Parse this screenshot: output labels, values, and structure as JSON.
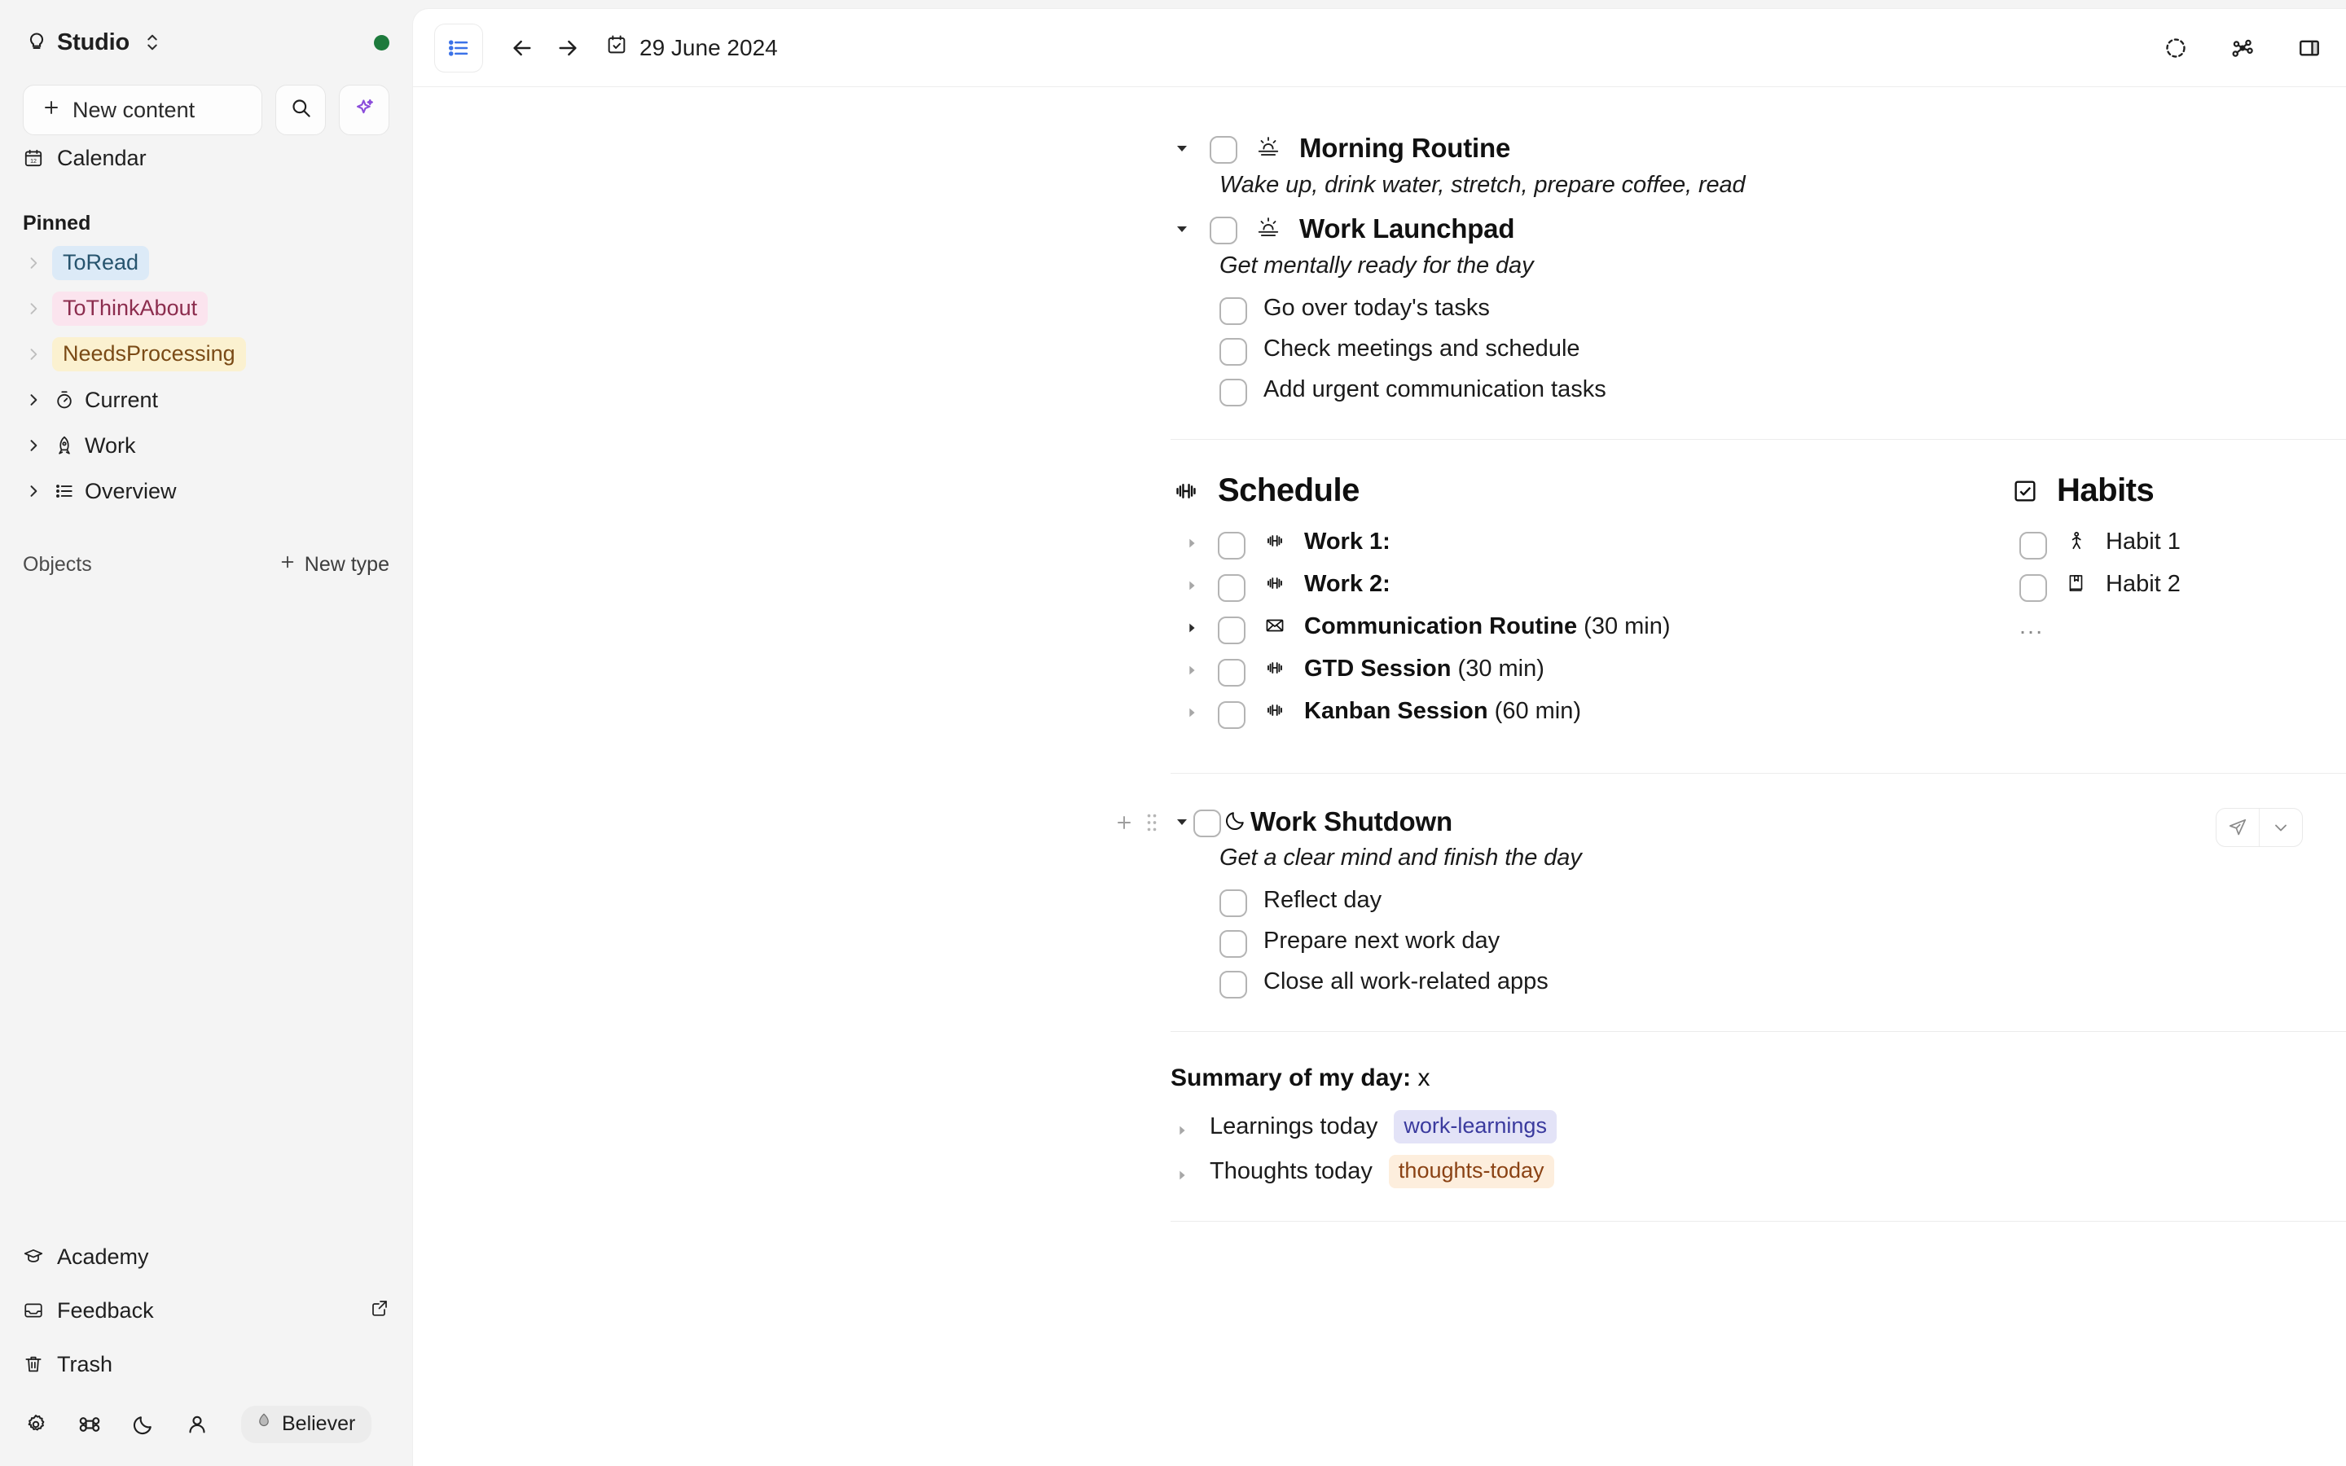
{
  "sidebar": {
    "space_name": "Studio",
    "space_icon": "bulb-icon",
    "status_dot_color": "#1d7a3c",
    "new_content_label": "New content",
    "search_icon": "search-icon",
    "ai_icon": "sparkles-icon",
    "calendar_label": "Calendar",
    "pinned_title": "Pinned",
    "pinned": [
      {
        "label": "ToRead",
        "bg": "#dceaf7",
        "fg": "#27546e",
        "kind": "tag"
      },
      {
        "label": "ToThinkAbout",
        "bg": "#fbe4ee",
        "fg": "#8c2d4e",
        "kind": "tag"
      },
      {
        "label": "NeedsProcessing",
        "bg": "#fbf1d0",
        "fg": "#7a4a16",
        "kind": "tag"
      }
    ],
    "tree": [
      {
        "label": "Current",
        "icon": "stopwatch-icon"
      },
      {
        "label": "Work",
        "icon": "rocket-icon"
      },
      {
        "label": "Overview",
        "icon": "list-icon"
      }
    ],
    "objects_title": "Objects",
    "new_type_label": "New type",
    "footer": [
      {
        "label": "Academy",
        "icon": "graduation-cap-icon",
        "external": false
      },
      {
        "label": "Feedback",
        "icon": "inbox-icon",
        "external": true
      },
      {
        "label": "Trash",
        "icon": "trash-icon",
        "external": false
      }
    ],
    "icon_bar": [
      "gear-icon",
      "command-icon",
      "moon-icon",
      "person-icon"
    ],
    "membership_label": "Believer",
    "membership_icon": "flame-icon"
  },
  "toolbar": {
    "view_icon": "list-view-icon",
    "back_icon": "arrow-left-icon",
    "forward_icon": "arrow-right-icon",
    "date_icon": "calendar-check-icon",
    "date": "29 June 2024",
    "right_icons": [
      "dashed-circle-icon",
      "graph-icon",
      "panel-right-icon",
      "more-horizontal-icon"
    ]
  },
  "document": {
    "blocks": [
      {
        "title": "Morning Routine",
        "icon": "sunrise-icon",
        "description": "Wake up, drink water, stretch, prepare coffee, read",
        "items": []
      },
      {
        "title": "Work Launchpad",
        "icon": "sunrise-icon",
        "description": "Get mentally ready for the day",
        "items": [
          "Go over today's tasks",
          "Check meetings and schedule",
          "Add urgent communication tasks"
        ]
      }
    ],
    "schedule": {
      "title": "Schedule",
      "icon": "dumbbell-icon",
      "rows": [
        {
          "name": "Work 1:",
          "icon": "dumbbell-icon",
          "duration": ""
        },
        {
          "name": "Work 2:",
          "icon": "dumbbell-icon",
          "duration": ""
        },
        {
          "name": "Communication Routine",
          "icon": "envelope-icon",
          "duration": " (30 min)"
        },
        {
          "name": "GTD Session",
          "icon": "dumbbell-icon",
          "duration": " (30 min)"
        },
        {
          "name": "Kanban Session",
          "icon": "dumbbell-icon",
          "duration": " (60 min)"
        }
      ]
    },
    "habits": {
      "title": "Habits",
      "icon": "checkbox-checked-icon",
      "rows": [
        {
          "name": "Habit 1",
          "icon": "walking-person-icon"
        },
        {
          "name": "Habit 2",
          "icon": "bookmark-book-icon"
        }
      ],
      "more": "..."
    },
    "shutdown": {
      "title": "Work Shutdown",
      "icon": "moon-icon",
      "description": "Get a clear mind and finish the day",
      "items": [
        "Reflect day",
        "Prepare next work day",
        "Close all work-related apps"
      ],
      "actions": [
        "send-icon",
        "chevron-down-icon"
      ],
      "gutter": [
        "plus-icon",
        "drag-handle-icon"
      ]
    },
    "summary": {
      "label": "Summary of my day:",
      "value": "x",
      "rows": [
        {
          "text": "Learnings today",
          "tag": "work-learnings",
          "tag_bg": "#e3e3f7",
          "tag_fg": "#3a3a9e"
        },
        {
          "text": "Thoughts today",
          "tag": "thoughts-today",
          "tag_bg": "#fdeedd",
          "tag_fg": "#8a4214"
        }
      ]
    }
  }
}
